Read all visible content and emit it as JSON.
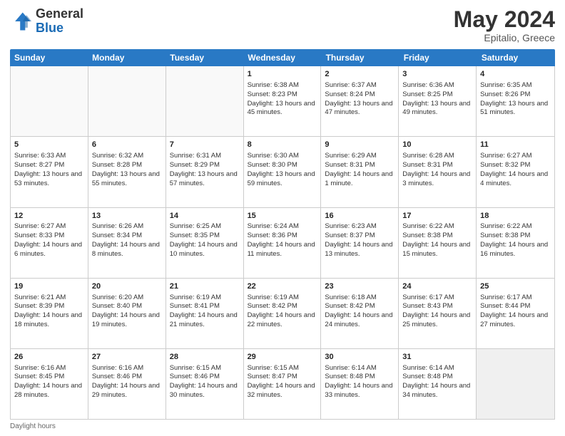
{
  "logo": {
    "general": "General",
    "blue": "Blue"
  },
  "header": {
    "month": "May 2024",
    "location": "Epitalio, Greece"
  },
  "days_of_week": [
    "Sunday",
    "Monday",
    "Tuesday",
    "Wednesday",
    "Thursday",
    "Friday",
    "Saturday"
  ],
  "footer": {
    "daylight_label": "Daylight hours"
  },
  "weeks": [
    [
      {
        "day": "",
        "sunrise": "",
        "sunset": "",
        "daylight": "",
        "empty": true
      },
      {
        "day": "",
        "sunrise": "",
        "sunset": "",
        "daylight": "",
        "empty": true
      },
      {
        "day": "",
        "sunrise": "",
        "sunset": "",
        "daylight": "",
        "empty": true
      },
      {
        "day": "1",
        "sunrise": "Sunrise: 6:38 AM",
        "sunset": "Sunset: 8:23 PM",
        "daylight": "Daylight: 13 hours and 45 minutes.",
        "empty": false
      },
      {
        "day": "2",
        "sunrise": "Sunrise: 6:37 AM",
        "sunset": "Sunset: 8:24 PM",
        "daylight": "Daylight: 13 hours and 47 minutes.",
        "empty": false
      },
      {
        "day": "3",
        "sunrise": "Sunrise: 6:36 AM",
        "sunset": "Sunset: 8:25 PM",
        "daylight": "Daylight: 13 hours and 49 minutes.",
        "empty": false
      },
      {
        "day": "4",
        "sunrise": "Sunrise: 6:35 AM",
        "sunset": "Sunset: 8:26 PM",
        "daylight": "Daylight: 13 hours and 51 minutes.",
        "empty": false
      }
    ],
    [
      {
        "day": "5",
        "sunrise": "Sunrise: 6:33 AM",
        "sunset": "Sunset: 8:27 PM",
        "daylight": "Daylight: 13 hours and 53 minutes.",
        "empty": false
      },
      {
        "day": "6",
        "sunrise": "Sunrise: 6:32 AM",
        "sunset": "Sunset: 8:28 PM",
        "daylight": "Daylight: 13 hours and 55 minutes.",
        "empty": false
      },
      {
        "day": "7",
        "sunrise": "Sunrise: 6:31 AM",
        "sunset": "Sunset: 8:29 PM",
        "daylight": "Daylight: 13 hours and 57 minutes.",
        "empty": false
      },
      {
        "day": "8",
        "sunrise": "Sunrise: 6:30 AM",
        "sunset": "Sunset: 8:30 PM",
        "daylight": "Daylight: 13 hours and 59 minutes.",
        "empty": false
      },
      {
        "day": "9",
        "sunrise": "Sunrise: 6:29 AM",
        "sunset": "Sunset: 8:31 PM",
        "daylight": "Daylight: 14 hours and 1 minute.",
        "empty": false
      },
      {
        "day": "10",
        "sunrise": "Sunrise: 6:28 AM",
        "sunset": "Sunset: 8:31 PM",
        "daylight": "Daylight: 14 hours and 3 minutes.",
        "empty": false
      },
      {
        "day": "11",
        "sunrise": "Sunrise: 6:27 AM",
        "sunset": "Sunset: 8:32 PM",
        "daylight": "Daylight: 14 hours and 4 minutes.",
        "empty": false
      }
    ],
    [
      {
        "day": "12",
        "sunrise": "Sunrise: 6:27 AM",
        "sunset": "Sunset: 8:33 PM",
        "daylight": "Daylight: 14 hours and 6 minutes.",
        "empty": false
      },
      {
        "day": "13",
        "sunrise": "Sunrise: 6:26 AM",
        "sunset": "Sunset: 8:34 PM",
        "daylight": "Daylight: 14 hours and 8 minutes.",
        "empty": false
      },
      {
        "day": "14",
        "sunrise": "Sunrise: 6:25 AM",
        "sunset": "Sunset: 8:35 PM",
        "daylight": "Daylight: 14 hours and 10 minutes.",
        "empty": false
      },
      {
        "day": "15",
        "sunrise": "Sunrise: 6:24 AM",
        "sunset": "Sunset: 8:36 PM",
        "daylight": "Daylight: 14 hours and 11 minutes.",
        "empty": false
      },
      {
        "day": "16",
        "sunrise": "Sunrise: 6:23 AM",
        "sunset": "Sunset: 8:37 PM",
        "daylight": "Daylight: 14 hours and 13 minutes.",
        "empty": false
      },
      {
        "day": "17",
        "sunrise": "Sunrise: 6:22 AM",
        "sunset": "Sunset: 8:38 PM",
        "daylight": "Daylight: 14 hours and 15 minutes.",
        "empty": false
      },
      {
        "day": "18",
        "sunrise": "Sunrise: 6:22 AM",
        "sunset": "Sunset: 8:38 PM",
        "daylight": "Daylight: 14 hours and 16 minutes.",
        "empty": false
      }
    ],
    [
      {
        "day": "19",
        "sunrise": "Sunrise: 6:21 AM",
        "sunset": "Sunset: 8:39 PM",
        "daylight": "Daylight: 14 hours and 18 minutes.",
        "empty": false
      },
      {
        "day": "20",
        "sunrise": "Sunrise: 6:20 AM",
        "sunset": "Sunset: 8:40 PM",
        "daylight": "Daylight: 14 hours and 19 minutes.",
        "empty": false
      },
      {
        "day": "21",
        "sunrise": "Sunrise: 6:19 AM",
        "sunset": "Sunset: 8:41 PM",
        "daylight": "Daylight: 14 hours and 21 minutes.",
        "empty": false
      },
      {
        "day": "22",
        "sunrise": "Sunrise: 6:19 AM",
        "sunset": "Sunset: 8:42 PM",
        "daylight": "Daylight: 14 hours and 22 minutes.",
        "empty": false
      },
      {
        "day": "23",
        "sunrise": "Sunrise: 6:18 AM",
        "sunset": "Sunset: 8:42 PM",
        "daylight": "Daylight: 14 hours and 24 minutes.",
        "empty": false
      },
      {
        "day": "24",
        "sunrise": "Sunrise: 6:17 AM",
        "sunset": "Sunset: 8:43 PM",
        "daylight": "Daylight: 14 hours and 25 minutes.",
        "empty": false
      },
      {
        "day": "25",
        "sunrise": "Sunrise: 6:17 AM",
        "sunset": "Sunset: 8:44 PM",
        "daylight": "Daylight: 14 hours and 27 minutes.",
        "empty": false
      }
    ],
    [
      {
        "day": "26",
        "sunrise": "Sunrise: 6:16 AM",
        "sunset": "Sunset: 8:45 PM",
        "daylight": "Daylight: 14 hours and 28 minutes.",
        "empty": false
      },
      {
        "day": "27",
        "sunrise": "Sunrise: 6:16 AM",
        "sunset": "Sunset: 8:46 PM",
        "daylight": "Daylight: 14 hours and 29 minutes.",
        "empty": false
      },
      {
        "day": "28",
        "sunrise": "Sunrise: 6:15 AM",
        "sunset": "Sunset: 8:46 PM",
        "daylight": "Daylight: 14 hours and 30 minutes.",
        "empty": false
      },
      {
        "day": "29",
        "sunrise": "Sunrise: 6:15 AM",
        "sunset": "Sunset: 8:47 PM",
        "daylight": "Daylight: 14 hours and 32 minutes.",
        "empty": false
      },
      {
        "day": "30",
        "sunrise": "Sunrise: 6:14 AM",
        "sunset": "Sunset: 8:48 PM",
        "daylight": "Daylight: 14 hours and 33 minutes.",
        "empty": false
      },
      {
        "day": "31",
        "sunrise": "Sunrise: 6:14 AM",
        "sunset": "Sunset: 8:48 PM",
        "daylight": "Daylight: 14 hours and 34 minutes.",
        "empty": false
      },
      {
        "day": "",
        "sunrise": "",
        "sunset": "",
        "daylight": "",
        "empty": true
      }
    ]
  ]
}
